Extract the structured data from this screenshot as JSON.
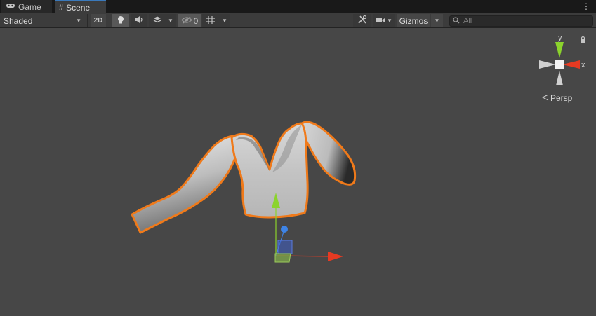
{
  "tabs": [
    {
      "label": "Game",
      "icon": "gamepad-icon",
      "active": false
    },
    {
      "label": "Scene",
      "icon": "hash-icon",
      "active": true
    }
  ],
  "tab_menu_glyph": "⋮",
  "toolbar": {
    "draw_mode": "Shaded",
    "btn_2d": "2D",
    "hidden_count": "0",
    "gizmos_label": "Gizmos",
    "search_placeholder": "All"
  },
  "scene_view": {
    "persp_label": "Persp",
    "axis_labels": {
      "y": "y",
      "x": "x"
    },
    "selection_color": "#f07a1a",
    "axis_colors": {
      "x": "#e63a22",
      "y": "#8bd32c",
      "z": "#3e84e6"
    }
  }
}
